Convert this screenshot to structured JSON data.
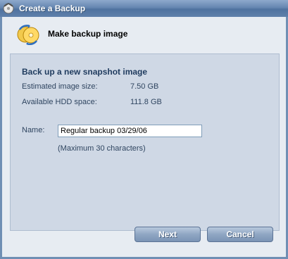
{
  "window": {
    "title": "Create a Backup",
    "accent_color": "#5f80ab"
  },
  "header": {
    "title": "Make backup image",
    "icon": "backup-discs-icon"
  },
  "panel": {
    "title": "Back up a new snapshot image",
    "estimated_size_label": "Estimated image size:",
    "estimated_size_value": "7.50 GB",
    "available_space_label": "Available HDD space:",
    "available_space_value": "111.8 GB",
    "name_label": "Name:",
    "name_value": "Regular backup 03/29/06",
    "name_hint": "(Maximum 30 characters)"
  },
  "buttons": {
    "next_label": "Next",
    "cancel_label": "Cancel"
  }
}
